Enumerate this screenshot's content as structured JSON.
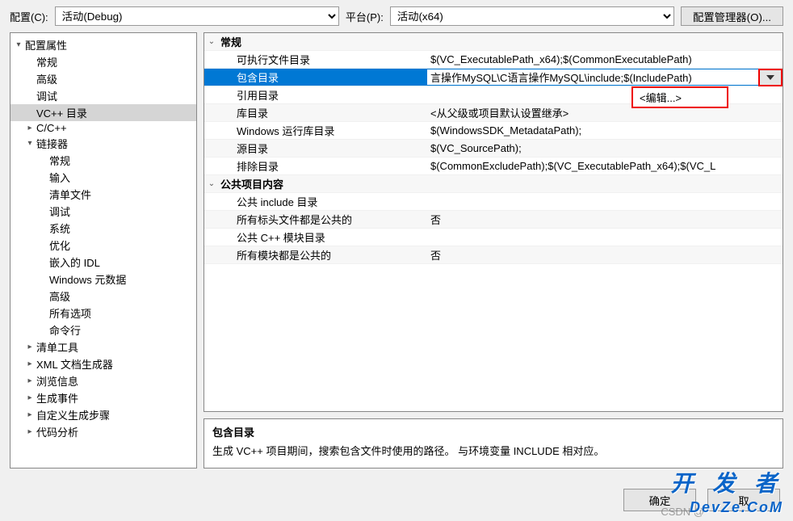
{
  "top": {
    "config_label": "配置(C):",
    "config_value": "活动(Debug)",
    "platform_label": "平台(P):",
    "platform_value": "活动(x64)",
    "config_mgr": "配置管理器(O)..."
  },
  "tree": [
    {
      "label": "配置属性",
      "tog": "▾",
      "ind": 0
    },
    {
      "label": "常规",
      "tog": "",
      "ind": 1
    },
    {
      "label": "高级",
      "tog": "",
      "ind": 1
    },
    {
      "label": "调试",
      "tog": "",
      "ind": 1
    },
    {
      "label": "VC++ 目录",
      "tog": "",
      "ind": 1,
      "sel": true
    },
    {
      "label": "C/C++",
      "tog": "▸",
      "ind": 1
    },
    {
      "label": "链接器",
      "tog": "▾",
      "ind": 1
    },
    {
      "label": "常规",
      "tog": "",
      "ind": 2
    },
    {
      "label": "输入",
      "tog": "",
      "ind": 2
    },
    {
      "label": "清单文件",
      "tog": "",
      "ind": 2
    },
    {
      "label": "调试",
      "tog": "",
      "ind": 2
    },
    {
      "label": "系统",
      "tog": "",
      "ind": 2
    },
    {
      "label": "优化",
      "tog": "",
      "ind": 2
    },
    {
      "label": "嵌入的 IDL",
      "tog": "",
      "ind": 2
    },
    {
      "label": "Windows 元数据",
      "tog": "",
      "ind": 2
    },
    {
      "label": "高级",
      "tog": "",
      "ind": 2
    },
    {
      "label": "所有选项",
      "tog": "",
      "ind": 2
    },
    {
      "label": "命令行",
      "tog": "",
      "ind": 2
    },
    {
      "label": "清单工具",
      "tog": "▸",
      "ind": 1
    },
    {
      "label": "XML 文档生成器",
      "tog": "▸",
      "ind": 1
    },
    {
      "label": "浏览信息",
      "tog": "▸",
      "ind": 1
    },
    {
      "label": "生成事件",
      "tog": "▸",
      "ind": 1
    },
    {
      "label": "自定义生成步骤",
      "tog": "▸",
      "ind": 1
    },
    {
      "label": "代码分析",
      "tog": "▸",
      "ind": 1
    }
  ],
  "grid": [
    {
      "name": "常规",
      "value": "",
      "group": true,
      "tog": "⌄"
    },
    {
      "name": "可执行文件目录",
      "value": "$(VC_ExecutablePath_x64);$(CommonExecutablePath)",
      "group": false
    },
    {
      "name": "包含目录",
      "value": "言操作MySQL\\C语言操作MySQL\\include;$(IncludePath)",
      "group": false,
      "sel": true
    },
    {
      "name": "引用目录",
      "value": "<编辑...>",
      "group": false,
      "popup": true
    },
    {
      "name": "库目录",
      "value": "<从父级或项目默认设置继承>",
      "group": false
    },
    {
      "name": "Windows 运行库目录",
      "value": "$(WindowsSDK_MetadataPath);",
      "group": false
    },
    {
      "name": "源目录",
      "value": "$(VC_SourcePath);",
      "group": false
    },
    {
      "name": "排除目录",
      "value": "$(CommonExcludePath);$(VC_ExecutablePath_x64);$(VC_L",
      "group": false
    },
    {
      "name": "公共项目内容",
      "value": "",
      "group": true,
      "tog": "⌄"
    },
    {
      "name": "公共 include 目录",
      "value": "",
      "group": false
    },
    {
      "name": "所有标头文件都是公共的",
      "value": "否",
      "group": false
    },
    {
      "name": "公共 C++ 模块目录",
      "value": "",
      "group": false
    },
    {
      "name": "所有模块都是公共的",
      "value": "否",
      "group": false
    }
  ],
  "popup": {
    "edit": "<编辑...>"
  },
  "desc": {
    "title": "包含目录",
    "text": "生成 VC++ 项目期间，搜索包含文件时使用的路径。   与环境变量 INCLUDE 相对应。"
  },
  "buttons": {
    "ok": "确定",
    "cancel": "取"
  },
  "watermark": {
    "big": "开 发 者",
    "url": "DevZe.CoM",
    "csdn": "CSDN @"
  }
}
